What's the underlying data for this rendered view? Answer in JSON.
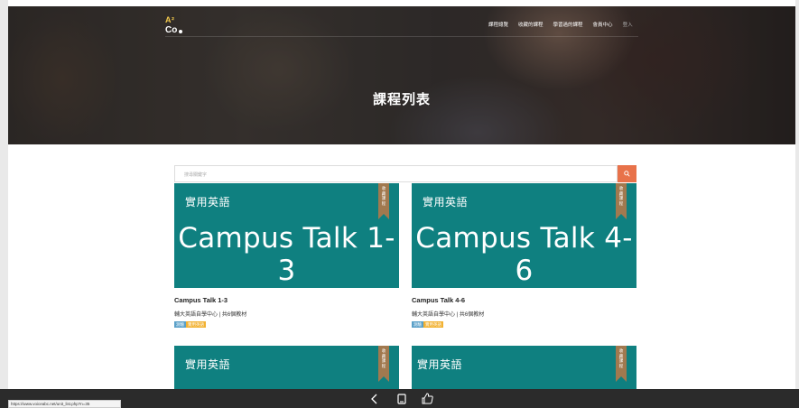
{
  "logo": {
    "line1": "A²",
    "line2": "Co"
  },
  "nav": {
    "items": [
      "課程總覽",
      "收藏的課程",
      "學習過的課程",
      "會員中心"
    ],
    "login": "登入"
  },
  "hero": {
    "title": "課程列表"
  },
  "search": {
    "placeholder": "搜尋關鍵字",
    "button_icon": "search-icon"
  },
  "cards": [
    {
      "category": "實用英語",
      "big_title": "Campus Talk 1-3",
      "ribbon": "收\n藏\n課\n程",
      "title": "Campus Talk 1-3",
      "meta": "輔大英語自學中心 | 共6個教材",
      "tags": [
        "測驗",
        "實用英語"
      ]
    },
    {
      "category": "實用英語",
      "big_title": "Campus Talk 4-6",
      "ribbon": "收\n藏\n課\n程",
      "title": "Campus Talk 4-6",
      "meta": "輔大英語自學中心 | 共6個教材",
      "tags": [
        "測驗",
        "實用英語"
      ]
    },
    {
      "category": "實用英語",
      "ribbon": "收\n藏\n課\n程"
    },
    {
      "category": "實用英語",
      "ribbon": "收\n藏\n課\n程"
    }
  ],
  "bottom_bar": {
    "icons": [
      "back-icon",
      "tablet-icon",
      "thumbs-up-icon"
    ],
    "glyphs": [
      "‹",
      "▯",
      "☝"
    ]
  },
  "status_url": "https://www.voiceabc.net/unit_list.php?n=35",
  "colors": {
    "card": "#0f8080",
    "accent": "#e8724a",
    "ribbon": "#a1794f"
  }
}
